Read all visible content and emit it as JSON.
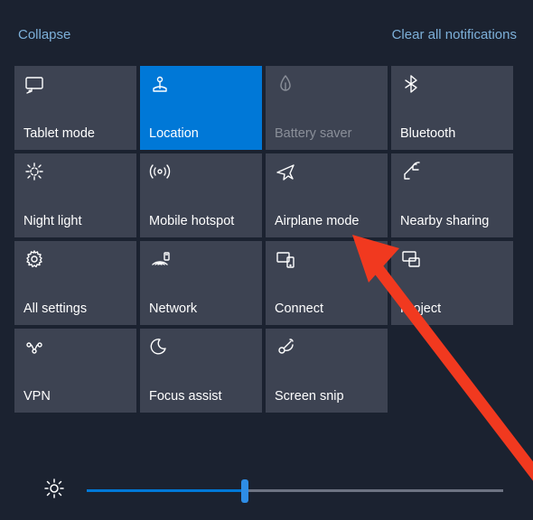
{
  "header": {
    "collapse": "Collapse",
    "clear": "Clear all notifications"
  },
  "tiles": [
    {
      "label": "Tablet mode",
      "icon": "tablet-mode",
      "state": "normal"
    },
    {
      "label": "Location",
      "icon": "location",
      "state": "active"
    },
    {
      "label": "Battery saver",
      "icon": "battery-saver",
      "state": "disabled"
    },
    {
      "label": "Bluetooth",
      "icon": "bluetooth",
      "state": "normal"
    },
    {
      "label": "Night light",
      "icon": "night-light",
      "state": "normal"
    },
    {
      "label": "Mobile hotspot",
      "icon": "mobile-hotspot",
      "state": "normal"
    },
    {
      "label": "Airplane mode",
      "icon": "airplane-mode",
      "state": "normal"
    },
    {
      "label": "Nearby sharing",
      "icon": "nearby-sharing",
      "state": "normal"
    },
    {
      "label": "All settings",
      "icon": "all-settings",
      "state": "normal"
    },
    {
      "label": "Network",
      "icon": "network",
      "state": "normal"
    },
    {
      "label": "Connect",
      "icon": "connect",
      "state": "normal"
    },
    {
      "label": "Project",
      "icon": "project",
      "state": "normal"
    },
    {
      "label": "VPN",
      "icon": "vpn",
      "state": "normal"
    },
    {
      "label": "Focus assist",
      "icon": "focus-assist",
      "state": "normal"
    },
    {
      "label": "Screen snip",
      "icon": "screen-snip",
      "state": "normal"
    }
  ],
  "brightness": {
    "percent": 38
  },
  "annotation": {
    "target_tile_index": 6
  }
}
